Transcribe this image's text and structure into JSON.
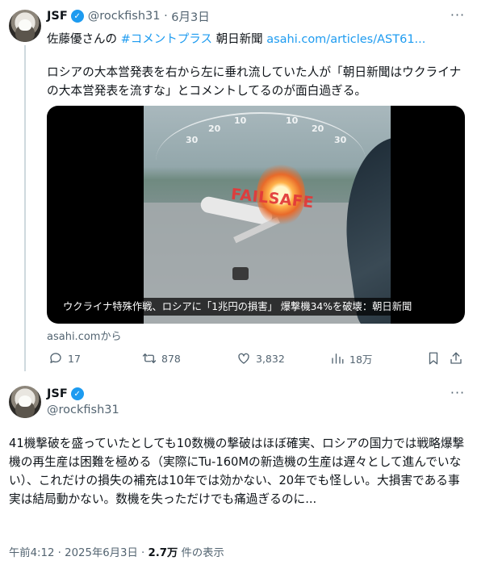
{
  "quoted_tweet": {
    "name": "JSF",
    "handle": "@rockfish31",
    "date": "6月3日",
    "more": "···",
    "line2_prefix": "佐藤優さんの",
    "hashtag": "#コメントプラス",
    "paper": "朝日新聞",
    "link": "asahi.com/articles/AST61...",
    "body": "ロシアの大本営発表を右から左に垂れ流していた人が「朝日新聞はウクライナの大本営発表を流すな」とコメントしてるのが面白過ぎる。",
    "media": {
      "overlay_text": "FAILSAFE",
      "dial_labels": [
        "30",
        "20",
        "10",
        "10",
        "20",
        "30"
      ],
      "caption": "ウクライナ特殊作戦、ロシアに「1兆円の損害」 爆撃機34%を破壊：朝日新聞"
    },
    "source": "asahi.comから",
    "stats": {
      "replies": "17",
      "reposts": "878",
      "likes": "3,832",
      "views": "18万"
    }
  },
  "main_tweet": {
    "name": "JSF",
    "handle": "@rockfish31",
    "more": "···",
    "body": "41機撃破を盛っていたとしても10数機の撃破はほぼ確実、ロシアの国力では戦略爆撃機の再生産は困難を極める（実際にTu-160Mの新造機の生産は遅々として進んでいない）、これだけの損失の補充は10年では効かない、20年でも怪しい。大損害である事実は結局動かない。数機を失っただけでも痛過ぎるのに...",
    "timestamp": "午前4:12 · 2025年6月3日 · ",
    "views_count": "2.7万",
    "views_label": " 件の表示"
  },
  "colors": {
    "accent": "#1d9bf0",
    "muted": "#536471",
    "text": "#0f1419",
    "failsafe": "#e23a3a"
  },
  "icons": [
    "verified-badge-icon",
    "more-icon",
    "reply-icon",
    "repost-icon",
    "like-icon",
    "views-icon",
    "bookmark-icon",
    "share-icon"
  ]
}
